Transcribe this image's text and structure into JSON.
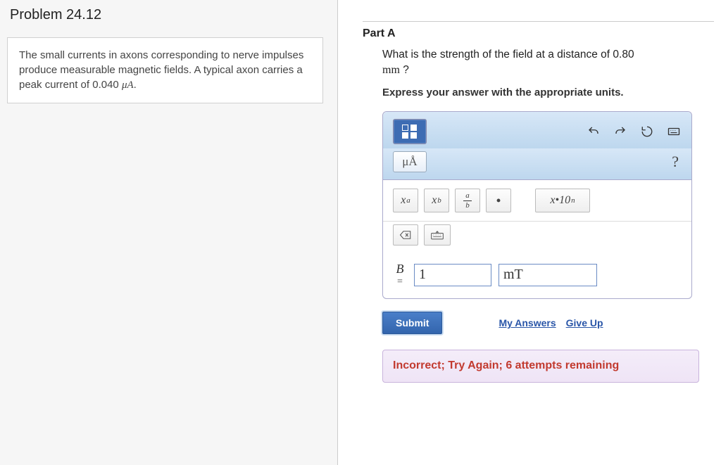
{
  "left": {
    "title": "Problem 24.12",
    "description_line1": "The small currents in axons corresponding to nerve impulses produce measurable magnetic fields. A typical axon carries a peak current of 0.040 ",
    "description_var": "μA",
    "description_end": "."
  },
  "right": {
    "part_label": "Part A",
    "question_line1": "What is the strength of the field at a distance of 0.80",
    "question_unit": "mm",
    "question_qmark": " ?",
    "instruction": "Express your answer with the appropriate units.",
    "toolbar": {
      "unit_chip": "μÅ",
      "help": "?",
      "ops": {
        "xa": "x",
        "xa_sup": "a",
        "xb": "x",
        "xb_sub": "b",
        "frac_top": "a",
        "frac_bot": "b",
        "dot": "•",
        "sci": "x•10",
        "sci_sup": "n"
      }
    },
    "answer": {
      "label_sym": "B",
      "label_eq": "=",
      "value": "1",
      "unit": "mT"
    },
    "submit": {
      "label": "Submit",
      "my_answers": "My Answers",
      "give_up": "Give Up"
    },
    "feedback": "Incorrect; Try Again; 6 attempts remaining"
  }
}
